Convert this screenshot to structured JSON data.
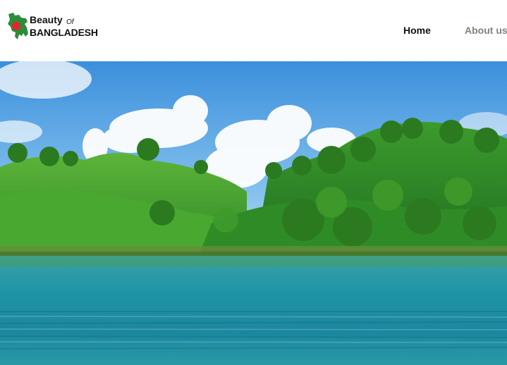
{
  "brand": {
    "line1": "Beauty",
    "of": "Of",
    "line2": "BANGLADESH",
    "colors": {
      "map_green": "#2e8b3a",
      "map_red": "#e3262e"
    }
  },
  "nav": {
    "items": [
      {
        "label": "Home",
        "active": true
      },
      {
        "label": "About us",
        "active": false
      }
    ]
  },
  "hero": {
    "icon": "landscape-photo",
    "colors": {
      "sky": "#4a9fe3",
      "hills": "#3a9a2b",
      "water": "#1b8ea3"
    }
  }
}
